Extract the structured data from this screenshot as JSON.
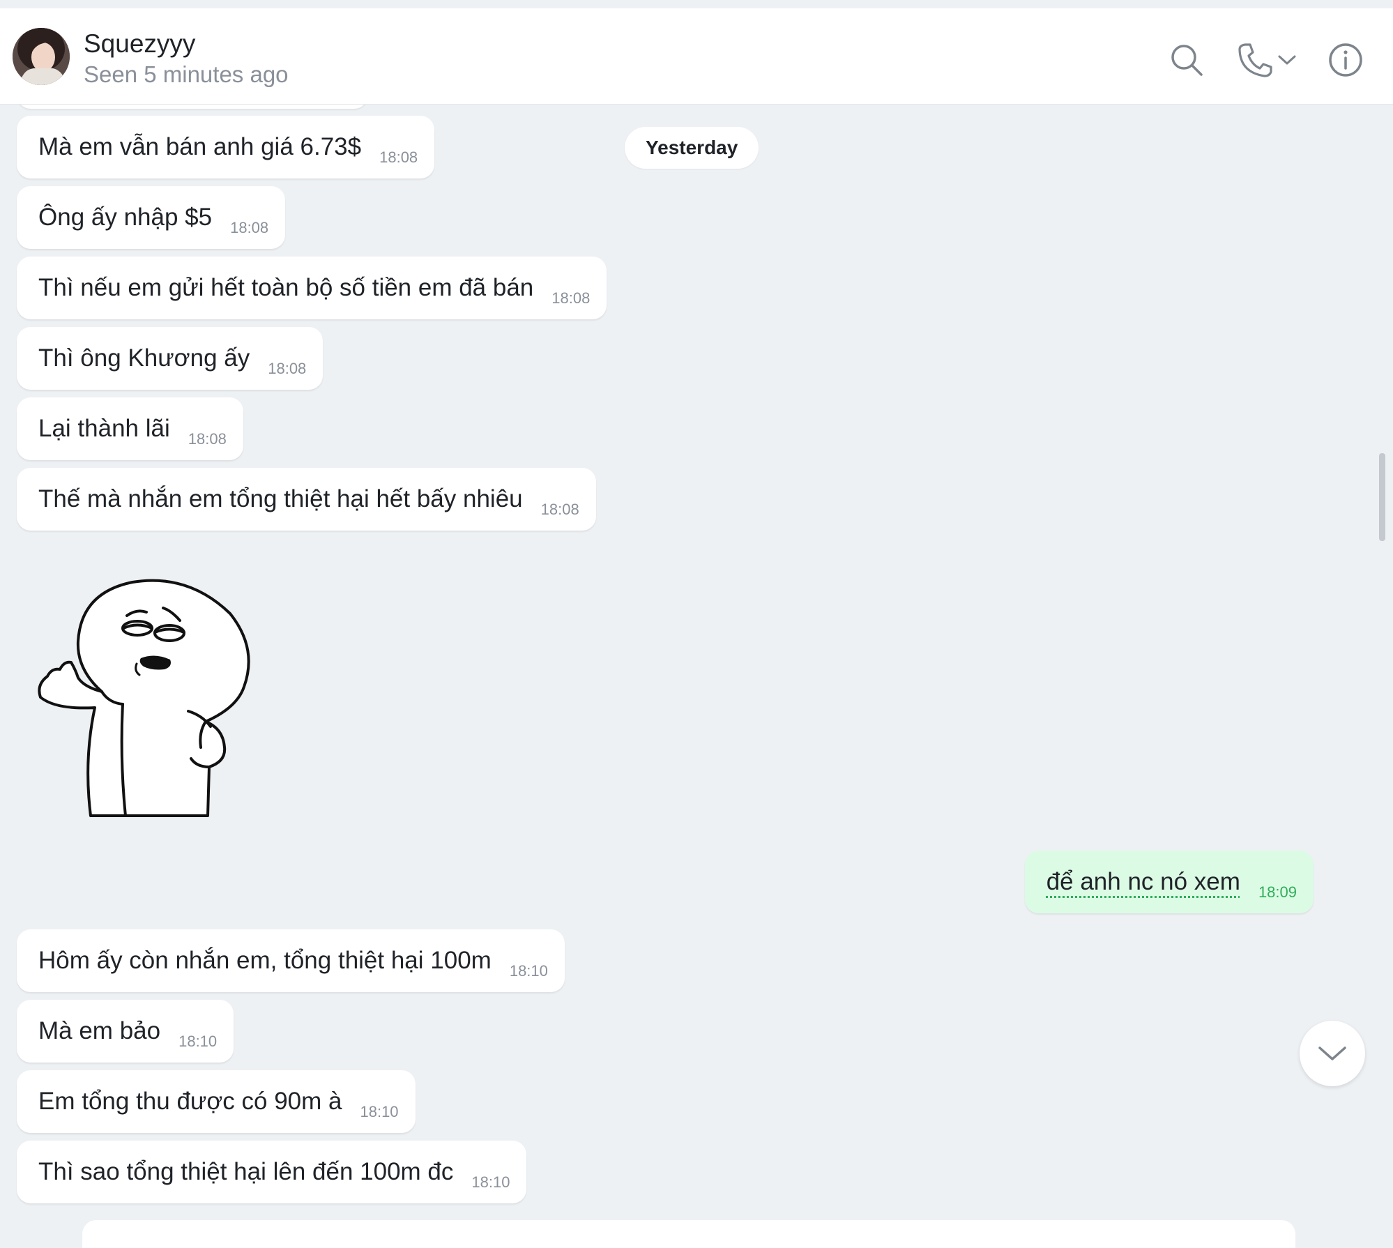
{
  "header": {
    "contact_name": "Squezyyy",
    "status": "Seen 5 minutes ago",
    "icons": [
      "search-icon",
      "phone-icon",
      "chevron-down-icon",
      "info-icon"
    ]
  },
  "date_separator": "Yesterday",
  "messages": [
    {
      "text": "Mà em vẫn bán anh giá 6.73$",
      "time": "18:08",
      "direction": "incoming"
    },
    {
      "text": "Ông ấy nhập $5",
      "time": "18:08",
      "direction": "incoming"
    },
    {
      "text": "Thì nếu em gửi hết toàn bộ số tiền em đã bán",
      "time": "18:08",
      "direction": "incoming"
    },
    {
      "text": "Thì ông Khương ấy",
      "time": "18:08",
      "direction": "incoming"
    },
    {
      "text": "Lại thành lãi",
      "time": "18:08",
      "direction": "incoming"
    },
    {
      "text": "Thế mà nhắn em tổng thiệt hại hết bấy nhiêu",
      "time": "18:08",
      "direction": "incoming"
    },
    {
      "text": "để anh nc nó xem",
      "time": "18:09",
      "direction": "outgoing"
    },
    {
      "text": "Hôm ấy còn nhắn em, tổng thiệt hại 100m",
      "time": "18:10",
      "direction": "incoming"
    },
    {
      "text": "Mà em bảo",
      "time": "18:10",
      "direction": "incoming"
    },
    {
      "text": "Em tổng thu được có 90m à",
      "time": "18:10",
      "direction": "incoming"
    },
    {
      "text": "Thì sao tổng thiệt hại lên đến 100m đc",
      "time": "18:10",
      "direction": "incoming"
    }
  ],
  "sticker": {
    "icon": "shrug-character-sticker"
  },
  "colors": {
    "background": "#eef1f4",
    "incoming_bubble": "#ffffff",
    "outgoing_bubble": "#dcfbe5",
    "outgoing_time": "#2fae5a",
    "muted_text": "#8a9099"
  }
}
